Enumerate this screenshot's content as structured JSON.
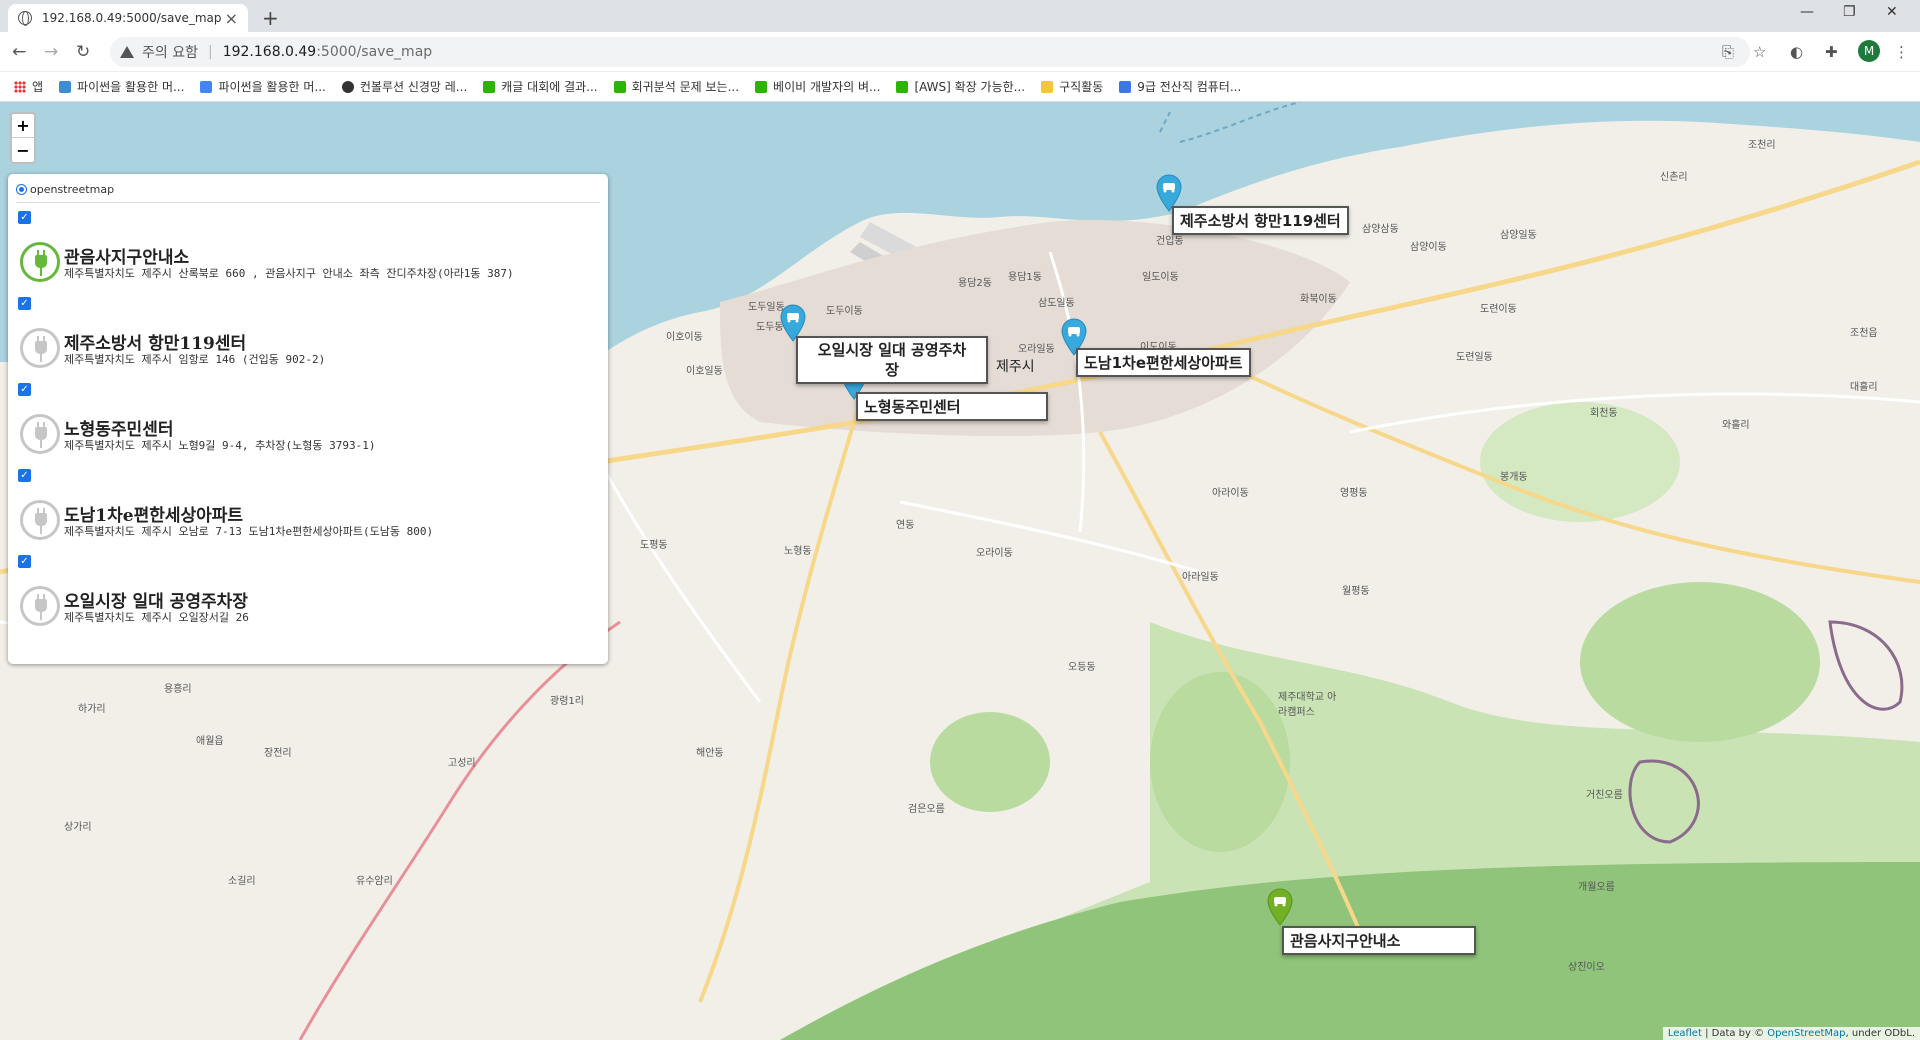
{
  "browser": {
    "tab_title": "192.168.0.49:5000/save_map",
    "security_label": "주의 요함",
    "url_host": "192.168.0.49",
    "url_path": ":5000/save_map",
    "profile_initial": "M"
  },
  "bookmarks": [
    {
      "label": "앱",
      "color": "#e34133"
    },
    {
      "label": "파이썬을 활용한 머...",
      "color": "#3b8ed6"
    },
    {
      "label": "파이썬을 활용한 머...",
      "color": "#4285f4"
    },
    {
      "label": "컨볼루션 신경망 레...",
      "color": "#333333"
    },
    {
      "label": "캐글 대회에 결과...",
      "color": "#2db400"
    },
    {
      "label": "회귀분석 문제 보는...",
      "color": "#2db400"
    },
    {
      "label": "베이비 개발자의 벼...",
      "color": "#2db400"
    },
    {
      "label": "[AWS] 확장 가능한...",
      "color": "#2db400"
    },
    {
      "label": "구직활동",
      "color": "#f6c342"
    },
    {
      "label": "9급 전산직 컴퓨터...",
      "color": "#3b78e7"
    }
  ],
  "map": {
    "zoom_in": "+",
    "zoom_out": "−",
    "base_layer": "openstreetmap",
    "attribution_leaflet": "Leaflet",
    "attribution_text": " | Data by © ",
    "attribution_osm": "OpenStreetMap",
    "attribution_suffix": ", under ODbL."
  },
  "layers": [
    {
      "title": "관음사지구안내소",
      "address": "제주특별자치도 제주시 산록북로 660 , 관음사지구 안내소 좌측 잔디주차장(아라1동 387)",
      "color": "green"
    },
    {
      "title": "제주소방서 항만119센터",
      "address": "제주특별자치도 제주시 임항로 146 (건입동 902-2)",
      "color": "gray"
    },
    {
      "title": "노형동주민센터",
      "address": "제주특별자치도 제주시 노형9길 9-4, 추차장(노형동 3793-1)",
      "color": "gray"
    },
    {
      "title": "도남1차e편한세상아파트",
      "address": "제주특별자치도 제주시 오남로 7-13 도남1차e편한세상아파트(도남동 800)",
      "color": "gray"
    },
    {
      "title": "오일시장 일대 공영주차장",
      "address": "제주특별자치도 제주시 오일장서길 26",
      "color": "gray"
    }
  ],
  "popups": {
    "hangman": "제주소방서 항만119센터",
    "oil_line1": "오일시장 일대 공영주차",
    "oil_line2": "장",
    "donam": "도남1차e편한세상아파트",
    "nohyeong": "노형동주민센터",
    "gwaneumsa": "관음사지구안내소"
  },
  "place_labels": {
    "l1": "삼양삼동",
    "l2": "삼양이동",
    "l3": "삼양일동",
    "l4": "조천리",
    "l5": "신촌리",
    "l6": "도련이동",
    "l7": "도련일동",
    "l8": "조천읍",
    "l9": "대흘리",
    "l10": "회천동",
    "l11": "와흘리",
    "l12": "봉개동",
    "l13": "아라이동",
    "l14": "영평동",
    "l15": "오라이동",
    "l16": "아라일동",
    "l17": "월평동",
    "l18": "오등동",
    "l19": "연동",
    "l20": "도두일동",
    "l21": "도두이동",
    "l22": "이호이동",
    "l23": "이호일동",
    "l24": "용담2동",
    "l25": "용담1동",
    "l26": "삼도일동",
    "l27": "오라일동",
    "l28": "이도이동",
    "l29": "일도이동",
    "l30": "화북이동",
    "l31": "건입동",
    "l32": "제주시",
    "l33": "노형동",
    "l34": "도평동",
    "l35": "해안동",
    "l36": "광령1리",
    "l37": "고성리",
    "l38": "장전리",
    "l39": "애월읍",
    "l40": "용흥리",
    "l41": "하가리",
    "l42": "상가리",
    "l43": "소길리",
    "l44": "유수암리",
    "l45": "검은오름",
    "l46": "제주대학교 아라캠퍼스",
    "l47": "거친오름",
    "l48": "개월오름",
    "l49": "상진이오",
    "l50": "도두동"
  }
}
